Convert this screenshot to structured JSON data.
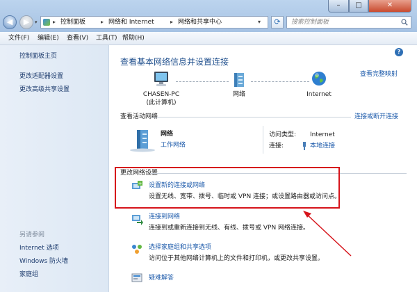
{
  "address": {
    "crumbs": [
      "控制面板",
      "网络和 Internet",
      "网络和共享中心"
    ]
  },
  "search": {
    "placeholder": "搜索控制面板"
  },
  "menu": [
    "文件(F)",
    "编辑(E)",
    "查看(V)",
    "工具(T)",
    "帮助(H)"
  ],
  "sidebar": {
    "top_links": [
      "控制面板主页",
      "更改适配器设置",
      "更改高级共享设置"
    ],
    "see_also_title": "另请参阅",
    "see_also_links": [
      "Internet 选项",
      "Windows 防火墙",
      "家庭组"
    ]
  },
  "main": {
    "title": "查看基本网络信息并设置连接",
    "view_full_map": "查看完整映射",
    "map": {
      "computer_name": "CHASEN-PC",
      "computer_sub": "(此计算机)",
      "network_label": "网络",
      "internet_label": "Internet"
    },
    "active_networks": {
      "title": "查看活动网络",
      "connect_disconnect": "连接或断开连接",
      "network_name": "网络",
      "network_type": "工作网络",
      "access_type_label": "访问类型:",
      "access_type_value": "Internet",
      "connections_label": "连接:",
      "connections_value": "本地连接"
    },
    "change_settings": {
      "title": "更改网络设置",
      "tasks": [
        {
          "title": "设置新的连接或网络",
          "desc": "设置无线、宽带、拨号、临时或 VPN 连接；或设置路由器或访问点。"
        },
        {
          "title": "连接到网络",
          "desc": "连接到或重新连接到无线、有线、拨号或 VPN 网络连接。"
        },
        {
          "title": "选择家庭组和共享选项",
          "desc": "访问位于其他网络计算机上的文件和打印机，或更改共享设置。"
        },
        {
          "title": "疑难解答",
          "desc": ""
        }
      ]
    }
  },
  "colors": {
    "accent": "#1e5bab",
    "highlight_box": "#d6141b",
    "title": "#1e4e8c"
  },
  "icons": [
    "back-icon",
    "forward-icon",
    "control-panel-icon",
    "refresh-icon",
    "search-icon",
    "help-icon",
    "computer-icon",
    "network-icon",
    "globe-icon",
    "network-building-icon",
    "ethernet-icon",
    "new-connection-icon",
    "connect-network-icon",
    "homegroup-icon",
    "troubleshoot-icon"
  ]
}
